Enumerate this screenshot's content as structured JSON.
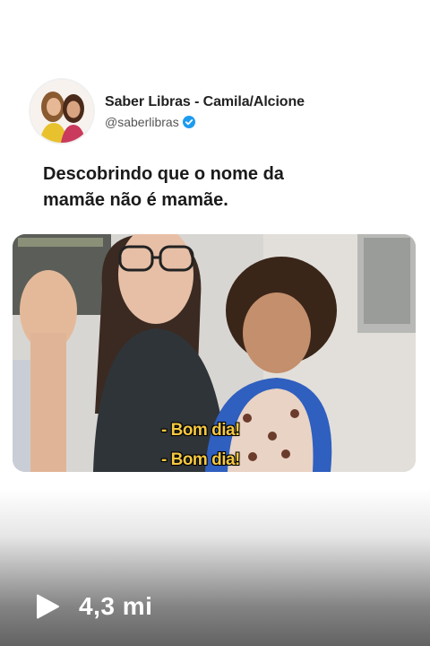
{
  "author": {
    "name": "Saber Libras - Camila/Alcione",
    "handle": "@saberlibras",
    "verified": true,
    "verified_color": "#1d9bf0"
  },
  "post": {
    "text": "Descobrindo que o nome da\nmamãe não é mamãe."
  },
  "video": {
    "captions": [
      "- Bom dia!",
      "- Bom dia!"
    ],
    "caption_color": "#f5c842"
  },
  "stats": {
    "play_icon": "play-icon",
    "views": "4,3 mi"
  }
}
